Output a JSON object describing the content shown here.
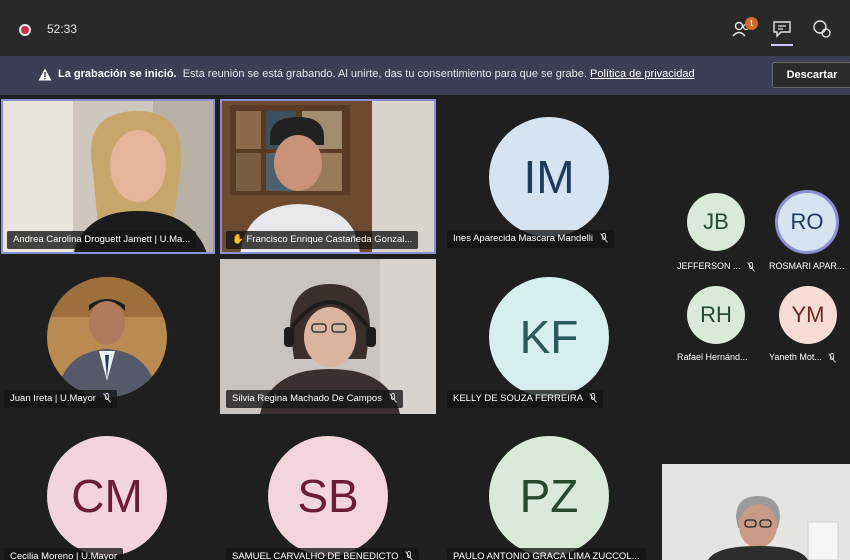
{
  "toolbar": {
    "timer": "52:33",
    "participants_badge": "1",
    "icons": [
      "record-icon",
      "participants-icon",
      "chat-icon",
      "reactions-icon"
    ]
  },
  "banner": {
    "bold": "La grabación se inició.",
    "text": "Esta reunión se está grabando. Al unirte, das tu consentimiento para que se grabe.",
    "link": "Política de privacidad",
    "dismiss": "Descartar"
  },
  "participants": {
    "andrea": "Andrea Carolina Droguett Jamett | U.Ma...",
    "francisco": "Francisco Enrique Castañeda Gonzal...",
    "ines": "Ines Aparecida Mascara Mandelli",
    "juan": "Juan Ireta | U.Mayor",
    "silvia": "Silvia Regina Machado De Campos",
    "kelly": "KELLY DE SOUZA FERREIRA",
    "cecilia": "Cecilia Moreno | U.Mayor",
    "samuel": "SAMUEL CARVALHO DE BENEDICTO",
    "paulo": "PAULO ANTONIO GRACA LIMA ZUCCOL...",
    "jefferson": "JEFFERSON ...",
    "rosmari": "ROSMARI APAR...",
    "rafael": "Rafael Hernánd...",
    "yaneth": "Yaneth Mot..."
  },
  "initials": {
    "im": "IM",
    "kf": "KF",
    "cm": "CM",
    "sb": "SB",
    "pz": "PZ",
    "jb": "JB",
    "ro": "RO",
    "rh": "RH",
    "ym": "YM"
  },
  "colors": {
    "accent": "#8c8fd6",
    "rec": "#c4314b",
    "im_bg": "#d6e3f0",
    "im_fg": "#1f3b5c",
    "kf_bg": "#d7eeee",
    "kf_fg": "#2a5a5a",
    "cm_bg": "#f2d4dc",
    "cm_fg": "#6b1d35",
    "sb_bg": "#f3d6dc",
    "sb_fg": "#6b1d35",
    "pz_bg": "#d9ead8",
    "pz_fg": "#274a2c"
  }
}
